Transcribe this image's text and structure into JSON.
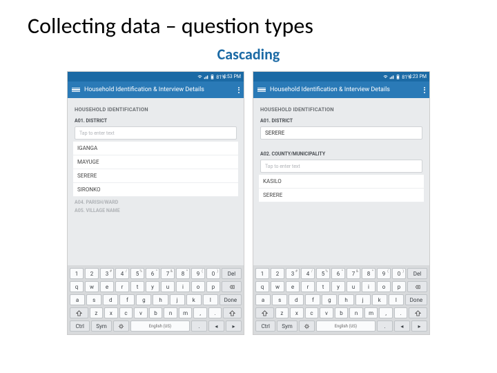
{
  "slide": {
    "title": "Collecting data – question types",
    "subtitle": "Cascading"
  },
  "left": {
    "status_time": "4:53 PM",
    "status_signal": "81%",
    "app_title": "Household Identification & Interview Details",
    "section": "HOUSEHOLD IDENTIFICATION",
    "q1_label": "A01. DISTRICT",
    "q1_hint": "Tap to enter text",
    "options": [
      "IGANGA",
      "MAYUGE",
      "SERERE",
      "SIRONKO"
    ],
    "q4_label": "A04. PARISH/WARD",
    "q5_label": "A05. VILLAGE NAME"
  },
  "right": {
    "status_time": "4:23 PM",
    "status_signal": "81%",
    "app_title": "Household Identification & Interview Details",
    "section": "HOUSEHOLD IDENTIFICATION",
    "q1_label": "A01. DISTRICT",
    "q1_value": "SERERE",
    "q2_label": "A02. COUNTY/MUNICIPALITY",
    "q2_hint": "Tap to enter text",
    "options": [
      "KASILO",
      "SERERE"
    ]
  },
  "keyboard": {
    "num_row": [
      {
        "main": "1",
        "sup": ""
      },
      {
        "main": "2",
        "sup": ""
      },
      {
        "main": "3",
        "sup": "#"
      },
      {
        "main": "4",
        "sup": "/"
      },
      {
        "main": "5",
        "sup": "%"
      },
      {
        "main": "6",
        "sup": "^"
      },
      {
        "main": "7",
        "sup": "&"
      },
      {
        "main": "8",
        "sup": "*"
      },
      {
        "main": "9",
        "sup": "("
      },
      {
        "main": "0",
        "sup": ")"
      }
    ],
    "row1": [
      "q",
      "w",
      "e",
      "r",
      "t",
      "y",
      "u",
      "i",
      "o",
      "p"
    ],
    "row2": [
      "a",
      "s",
      "d",
      "f",
      "g",
      "h",
      "j",
      "k",
      "l"
    ],
    "row3": [
      "z",
      "x",
      "c",
      "v",
      "b",
      "n",
      "m",
      ",",
      ".",
      "?"
    ],
    "del_label": "Del",
    "done_label": "Done",
    "ctrl_label": "Ctrl",
    "sym_label": "Sym",
    "space_label": "English (US)"
  }
}
